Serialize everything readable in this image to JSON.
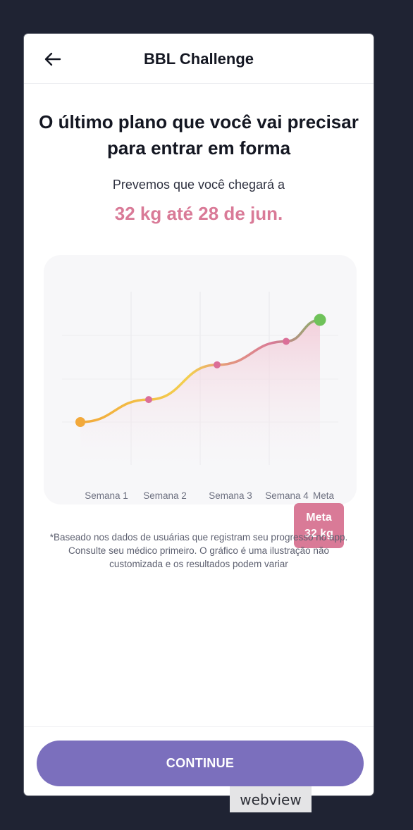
{
  "header": {
    "title": "BBL Challenge",
    "back_icon": "arrow-left-icon"
  },
  "main": {
    "headline": "O último plano que você vai precisar para entrar em forma",
    "subtitle": "Prevemos que você chegará a",
    "target": "32 kg até 28 de jun.",
    "disclaimer": "*Baseado nos dados de usuárias que registram seu progresso no app. Consulte seu médico primeiro. O gráfico é uma ilustração não customizada e os resultados podem variar"
  },
  "chart_data": {
    "type": "line",
    "title": "",
    "xlabel": "",
    "ylabel": "",
    "categories": [
      "Semana 1",
      "Semana 2",
      "Semana 3",
      "Semana 4",
      "Meta"
    ],
    "values": [
      0,
      0.22,
      0.56,
      0.79,
      1
    ],
    "tooltip": {
      "label": "Meta",
      "value": "32 kg"
    },
    "grid": true,
    "colors": {
      "start": "#f2a93b",
      "mid": "#f3cf4f",
      "end": "#d97a97",
      "goal": "#6fc25a",
      "point": "#db6f98",
      "fill": "#f2c9d6"
    }
  },
  "footer": {
    "continue_label": "CONTINUE"
  },
  "overlay": {
    "webview_label": "webview"
  },
  "colors": {
    "accent": "#7b6fbd",
    "highlight": "#d97a97",
    "background": "#1f2333"
  }
}
